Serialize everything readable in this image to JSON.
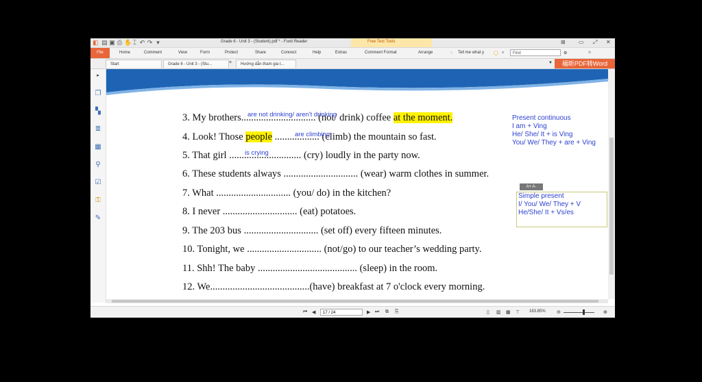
{
  "window": {
    "title": "Grade 6 - Unit 3 - (Student).pdf * - Foxit Reader",
    "context_tab": "Free Text Tools"
  },
  "menu": {
    "file": "File",
    "items": [
      "Home",
      "Comment",
      "View",
      "Form",
      "Protect",
      "Share",
      "Connect",
      "Help",
      "Extras",
      "Comment Format",
      "Arrange"
    ],
    "tell_me": "Tell me what y",
    "find_placeholder": "Find"
  },
  "tabs": [
    "Start",
    "Grade 6 - Unit 3 - (Stu...",
    "Hướng dẫn tham gia t..."
  ],
  "promo": "福昕PDF转Word",
  "exercise": [
    {
      "num": "3.",
      "pre": "My brothers",
      "dots": "..............................",
      "post": "(not/ drink) coffee",
      "tail": "at the moment.",
      "answer": "are not drinking/ aren't drinking"
    },
    {
      "num": "4.",
      "pre": "Look! Those",
      "hl": "people",
      "dots": "..................",
      "post": "(climb) the mountain so fast.",
      "answer": "are climbing"
    },
    {
      "num": "5.",
      "pre": "That girl",
      "dots": ".............................",
      "post": "(cry) loudly in the party now.",
      "answer": "is crying"
    },
    {
      "num": "6.",
      "pre": "These students always",
      "dots": "..............................",
      "post": "(wear) warm clothes in summer."
    },
    {
      "num": "7.",
      "pre": "What",
      "dots": "..............................",
      "post": "(you/ do) in the kitchen?"
    },
    {
      "num": "8.",
      "pre": "I never",
      "dots": "..............................",
      "post": "(eat) potatoes."
    },
    {
      "num": "9.",
      "pre": "The 203 bus",
      "dots": "..............................",
      "post": "(set off) every fifteen minutes."
    },
    {
      "num": "10.",
      "pre": "Tonight, we",
      "dots": "..............................",
      "post": "(not/go) to our teacher’s wedding party."
    },
    {
      "num": "11.",
      "pre": "Shh! The baby",
      "dots": "........................................",
      "post": "(sleep) in the room."
    },
    {
      "num": "12.",
      "pre": "We",
      "dots": "........................................",
      "post": "(have) breakfast at 7 o'clock every morning."
    }
  ],
  "notes": {
    "present_continuous": [
      "Present continuous",
      "I am + Ving",
      "He/ She/ It + is Ving",
      "You/ We/ They + are + Ving"
    ],
    "simple_present": [
      "Simple present",
      "I/ You/ We/ They + V",
      "He/She/ It + Vs/es"
    ],
    "format_buttons": "A+ A-"
  },
  "status": {
    "page": "17 / 24",
    "zoom": "163.85%"
  }
}
